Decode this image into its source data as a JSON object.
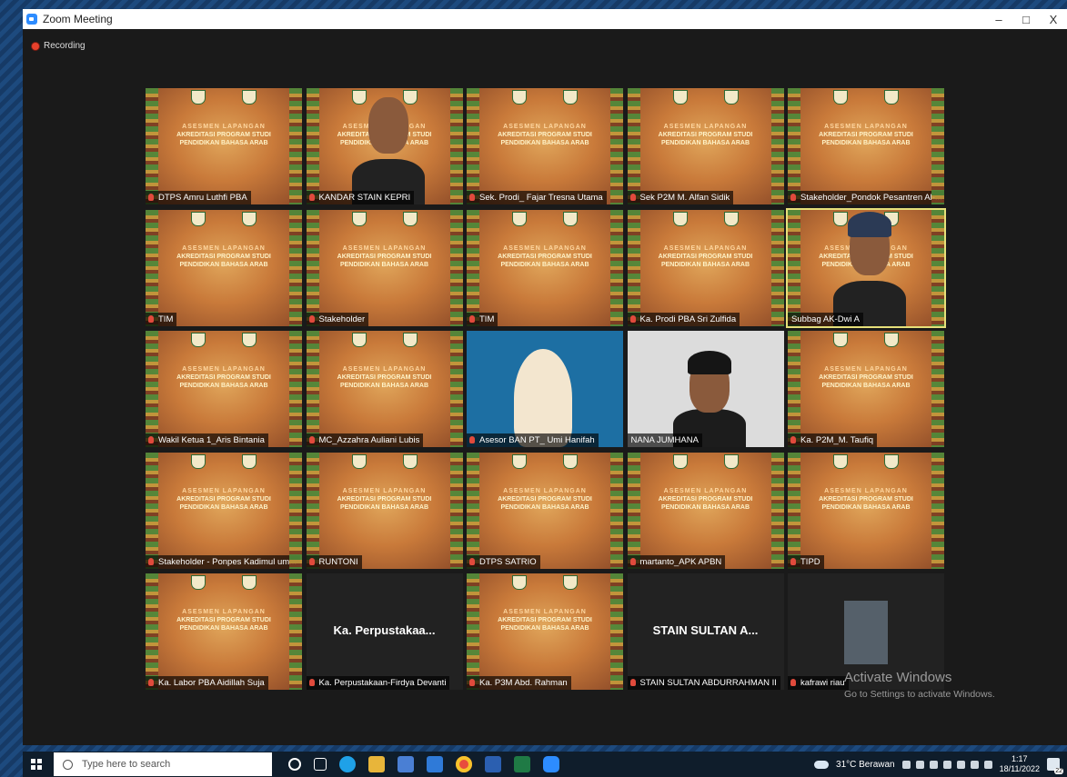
{
  "window": {
    "title": "Zoom Meeting",
    "controls": [
      "–",
      "□",
      "X"
    ],
    "recording_label": "Recording"
  },
  "slide": {
    "line1": "ASESMEN LAPANGAN",
    "line2": "AKREDITASI PROGRAM STUDI",
    "line3": "PENDIDIKAN BAHASA ARAB"
  },
  "tiles": [
    {
      "name": "DTPS Amru Luthfi PBA",
      "kind": "slide",
      "muted": true
    },
    {
      "name": "KANDAR STAIN KEPRI",
      "kind": "person",
      "muted": true
    },
    {
      "name": "Sek. Prodi_ Fajar Tresna Utama",
      "kind": "slide",
      "muted": true
    },
    {
      "name": "Sek P2M M. Alfan Sidik",
      "kind": "slide",
      "muted": true
    },
    {
      "name": "Stakeholder_Pondok Pesantren Al-...",
      "kind": "slide",
      "muted": true
    },
    {
      "name": "TIM",
      "kind": "slide",
      "muted": true
    },
    {
      "name": "Stakeholder",
      "kind": "slide",
      "muted": true
    },
    {
      "name": "TIM",
      "kind": "slide",
      "muted": true
    },
    {
      "name": "Ka. Prodi PBA Sri Zulfida",
      "kind": "slide",
      "muted": true
    },
    {
      "name": "Subbag AK-Dwi A",
      "kind": "speaker",
      "muted": false
    },
    {
      "name": "Wakil Ketua 1_Aris Bintania",
      "kind": "slide",
      "muted": true
    },
    {
      "name": "MC_Azzahra Auliani Lubis",
      "kind": "slide",
      "muted": true
    },
    {
      "name": "Asesor BAN PT_ Umi Hanifah",
      "kind": "blue",
      "muted": true
    },
    {
      "name": "NANA JUMHANA",
      "kind": "white",
      "muted": false
    },
    {
      "name": "Ka. P2M_M. Taufiq",
      "kind": "slide",
      "muted": true
    },
    {
      "name": "Stakeholder - Ponpes Kadimul um...",
      "kind": "slide",
      "muted": true
    },
    {
      "name": "RUNTONI",
      "kind": "slide",
      "muted": true
    },
    {
      "name": "DTPS SATRIO",
      "kind": "slide",
      "muted": true
    },
    {
      "name": "martanto_APK APBN",
      "kind": "slide",
      "muted": true
    },
    {
      "name": "TIPD",
      "kind": "slide",
      "muted": true
    },
    {
      "name": "Ka. Labor PBA Aidillah Suja",
      "kind": "slide",
      "muted": true
    },
    {
      "name": "Ka. Perpustakaan-Firdya Devanti",
      "kind": "blank",
      "muted": true,
      "big_label": "Ka. Perpustakaa..."
    },
    {
      "name": "Ka. P3M Abd. Rahman",
      "kind": "slide",
      "muted": true
    },
    {
      "name": "STAIN SULTAN ABDURRAHMAN II",
      "kind": "blank",
      "muted": true,
      "big_label": "STAIN SULTAN A..."
    },
    {
      "name": "kafrawi riau",
      "kind": "thumb",
      "muted": true
    }
  ],
  "watermark": {
    "title": "Activate Windows",
    "subtitle": "Go to Settings to activate Windows."
  },
  "taskbar": {
    "search_placeholder": "Type here to search",
    "weather": "31°C Berawan",
    "time": "1:17",
    "date": "18/11/2022",
    "notifications": "22"
  }
}
